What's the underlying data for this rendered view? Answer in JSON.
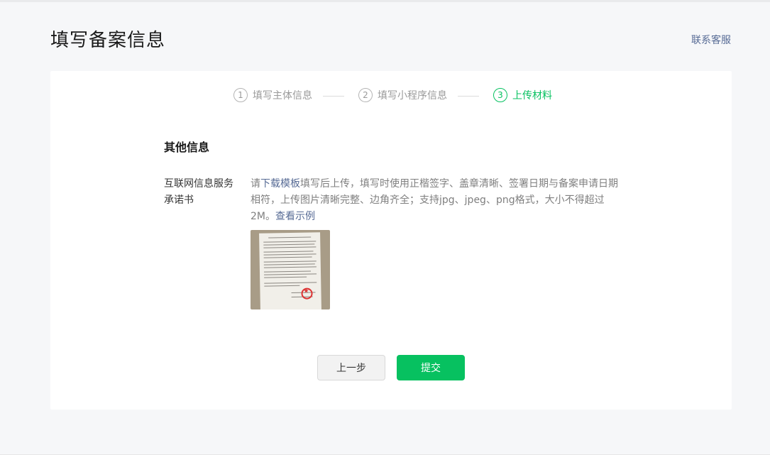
{
  "header": {
    "title": "填写备案信息",
    "contact_label": "联系客服"
  },
  "steps": [
    {
      "num": "1",
      "label": "填写主体信息",
      "active": false
    },
    {
      "num": "2",
      "label": "填写小程序信息",
      "active": false
    },
    {
      "num": "3",
      "label": "上传材料",
      "active": true
    }
  ],
  "section": {
    "title": "其他信息"
  },
  "field": {
    "label": "互联网信息服务承诺书",
    "desc_prefix": "请",
    "download_link": "下载模板",
    "desc_body": "填写后上传，填写时使用正楷签字、盖章清晰、签署日期与备案申请日期相符，上传图片清晰完整、边角齐全；支持jpg、jpeg、png格式，大小不得超过2M。",
    "example_link": "查看示例"
  },
  "actions": {
    "prev_label": "上一步",
    "submit_label": "提交"
  },
  "colors": {
    "accent": "#07c160",
    "link": "#576b95"
  }
}
